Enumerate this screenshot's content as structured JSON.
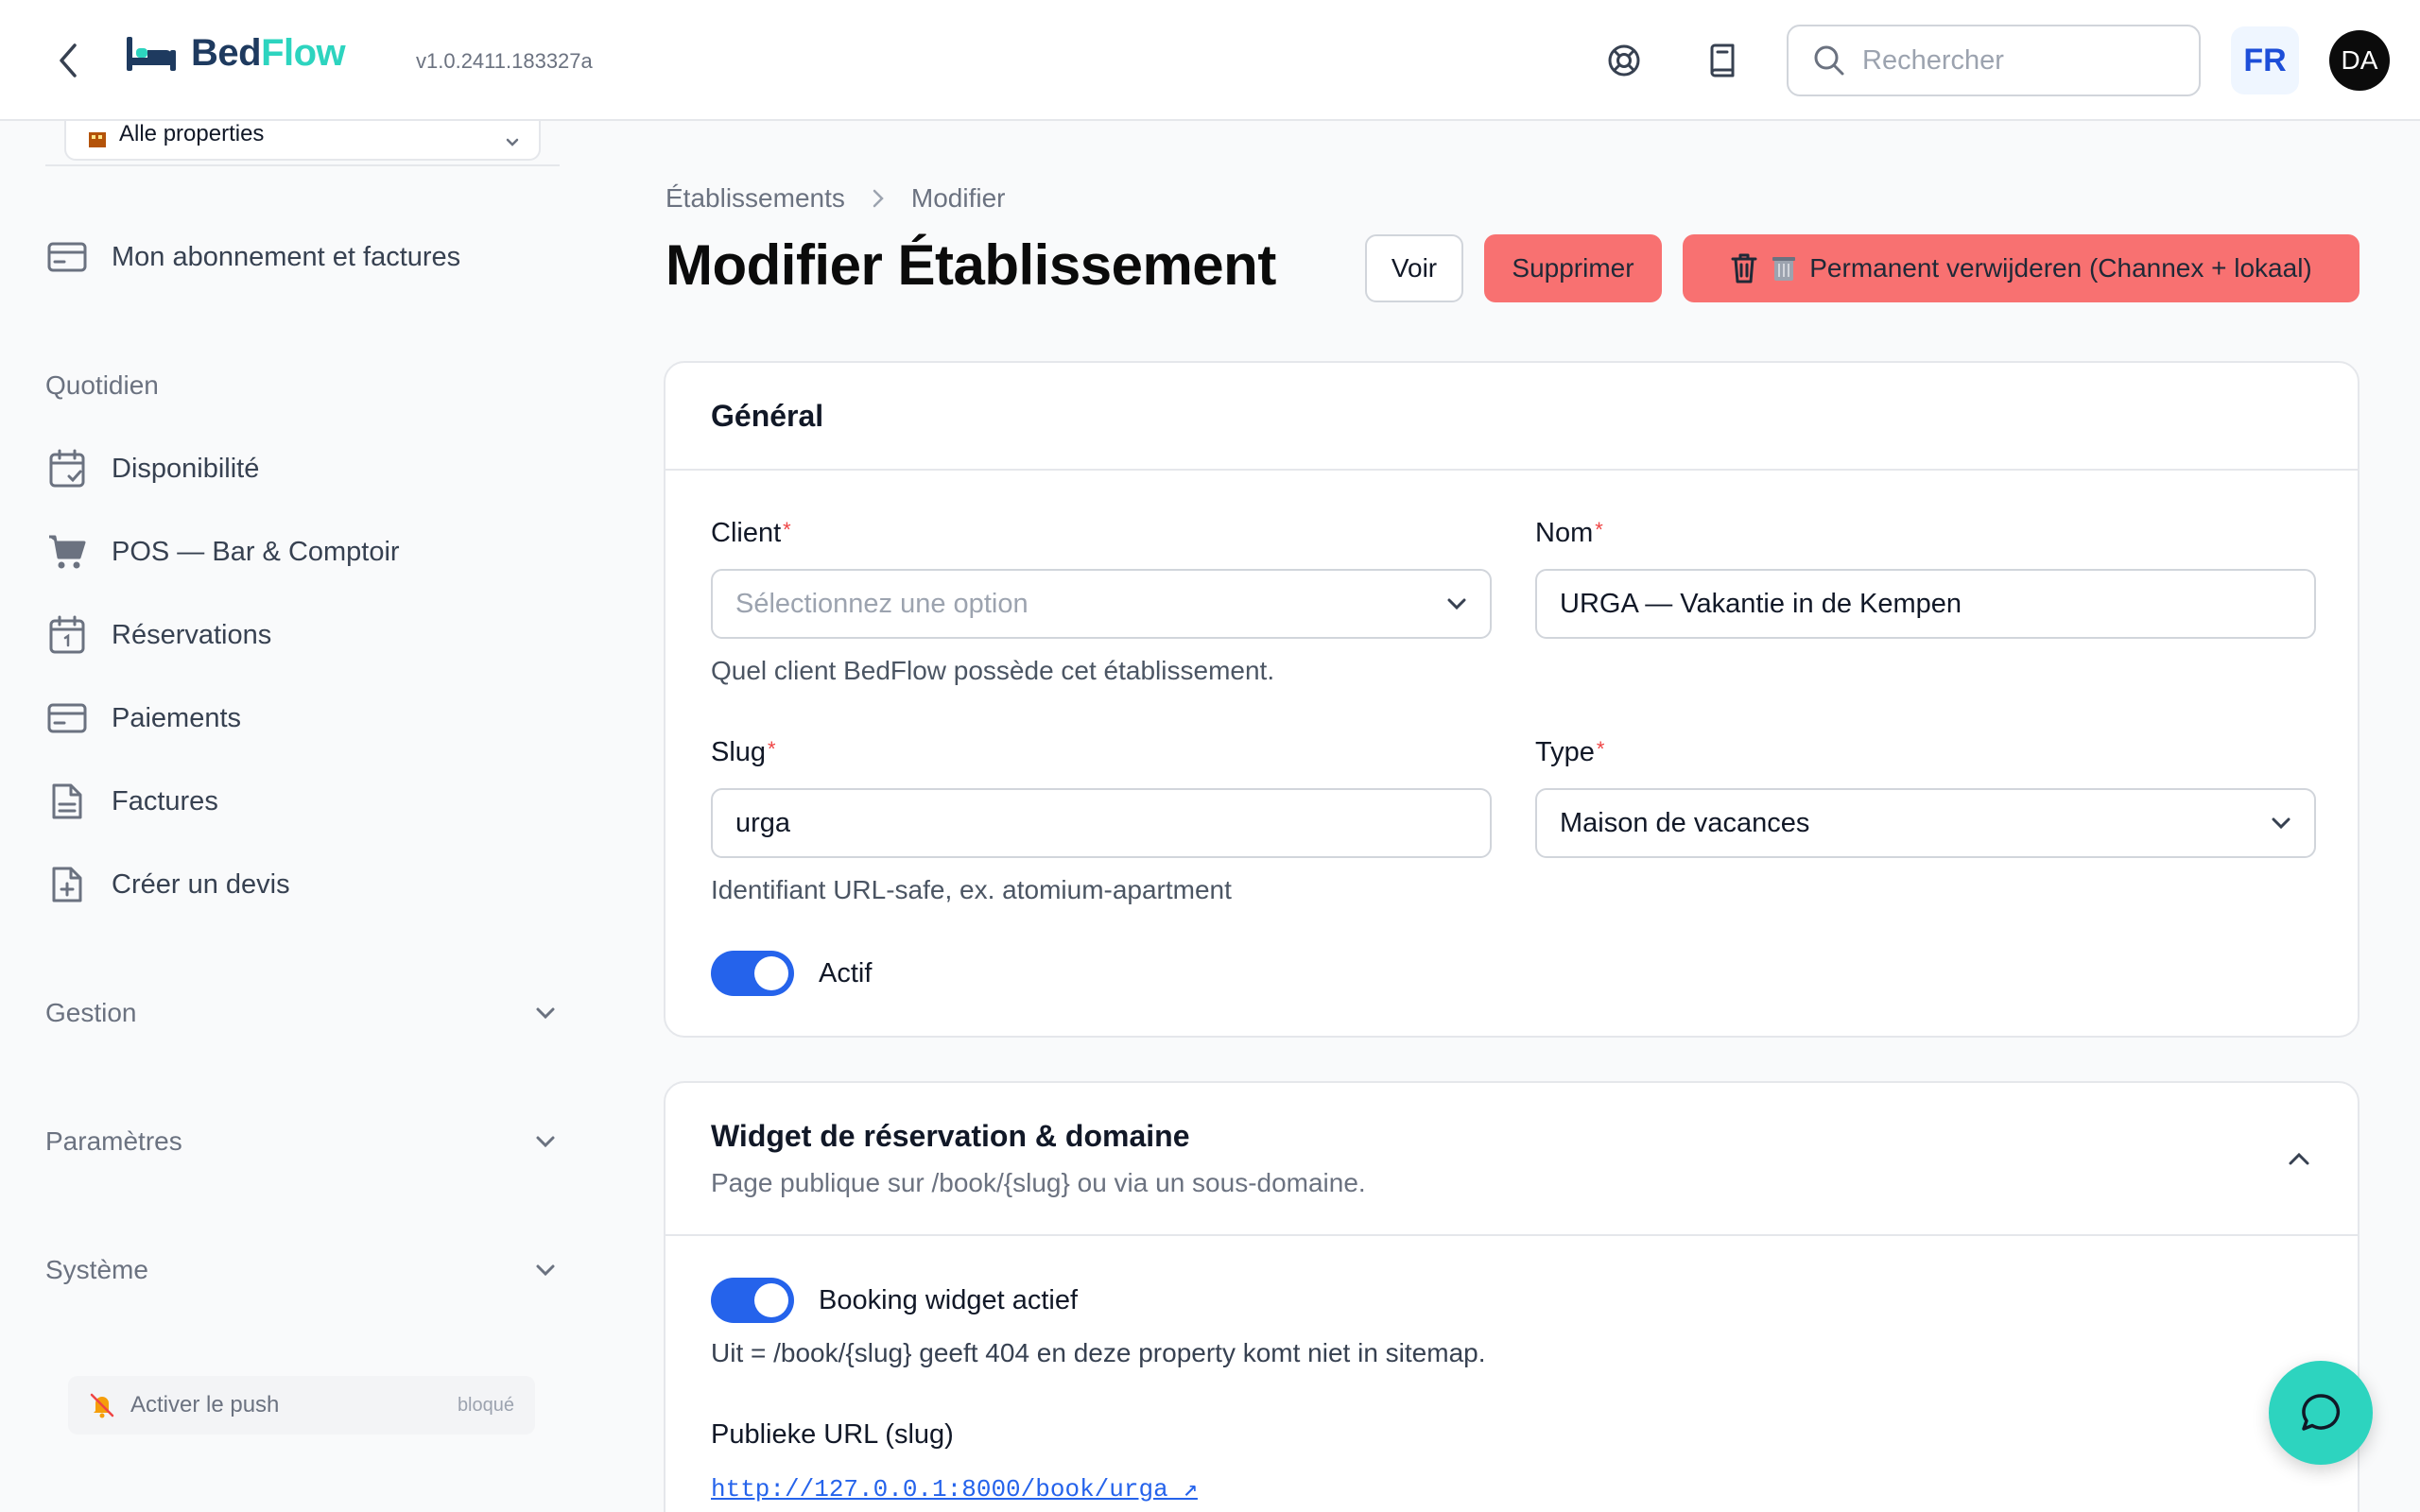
{
  "header": {
    "brand_part1": "Bed",
    "brand_part2": "Flow",
    "version": "v1.0.2411.183327a",
    "search_placeholder": "Rechercher",
    "lang": "FR",
    "user_initials": "DA"
  },
  "sidebar": {
    "property_select": "Alle properties",
    "top_item": "Mon abonnement et factures",
    "group_daily": "Quotidien",
    "daily_items": [
      "Disponibilité",
      "POS — Bar & Comptoir",
      "Réservations",
      "Paiements",
      "Factures",
      "Créer un devis"
    ],
    "groups": [
      "Gestion",
      "Paramètres",
      "Système"
    ],
    "push_label": "Activer le push",
    "push_state": "bloqué"
  },
  "page": {
    "breadcrumb": [
      "Établissements",
      "Modifier"
    ],
    "title": "Modifier Établissement",
    "btn_view": "Voir",
    "btn_delete": "Supprimer",
    "btn_perm_delete": "Permanent verwijderen (Channex + lokaal)"
  },
  "general": {
    "title": "Général",
    "client_label": "Client",
    "client_placeholder": "Sélectionnez une option",
    "client_hint": "Quel client BedFlow possède cet établissement.",
    "name_label": "Nom",
    "name_value": "URGA — Vakantie in de Kempen",
    "slug_label": "Slug",
    "slug_value": "urga",
    "slug_hint": "Identifiant URL-safe, ex. atomium-apartment",
    "type_label": "Type",
    "type_value": "Maison de vacances",
    "active_label": "Actif",
    "required_mark": "*"
  },
  "widget": {
    "title": "Widget de réservation & domaine",
    "subtitle": "Page publique sur /book/{slug} ou via un sous-domaine.",
    "toggle_label": "Booking widget actief",
    "toggle_hint": "Uit = /book/{slug} geeft 404 en deze property komt niet in sitemap.",
    "url_label": "Publieke URL (slug)",
    "url_value": "http://127.0.0.1:8000/book/urga ↗"
  },
  "colors": {
    "accent": "#2563eb",
    "brand_teal": "#2dd4bf",
    "danger": "#f87171"
  }
}
